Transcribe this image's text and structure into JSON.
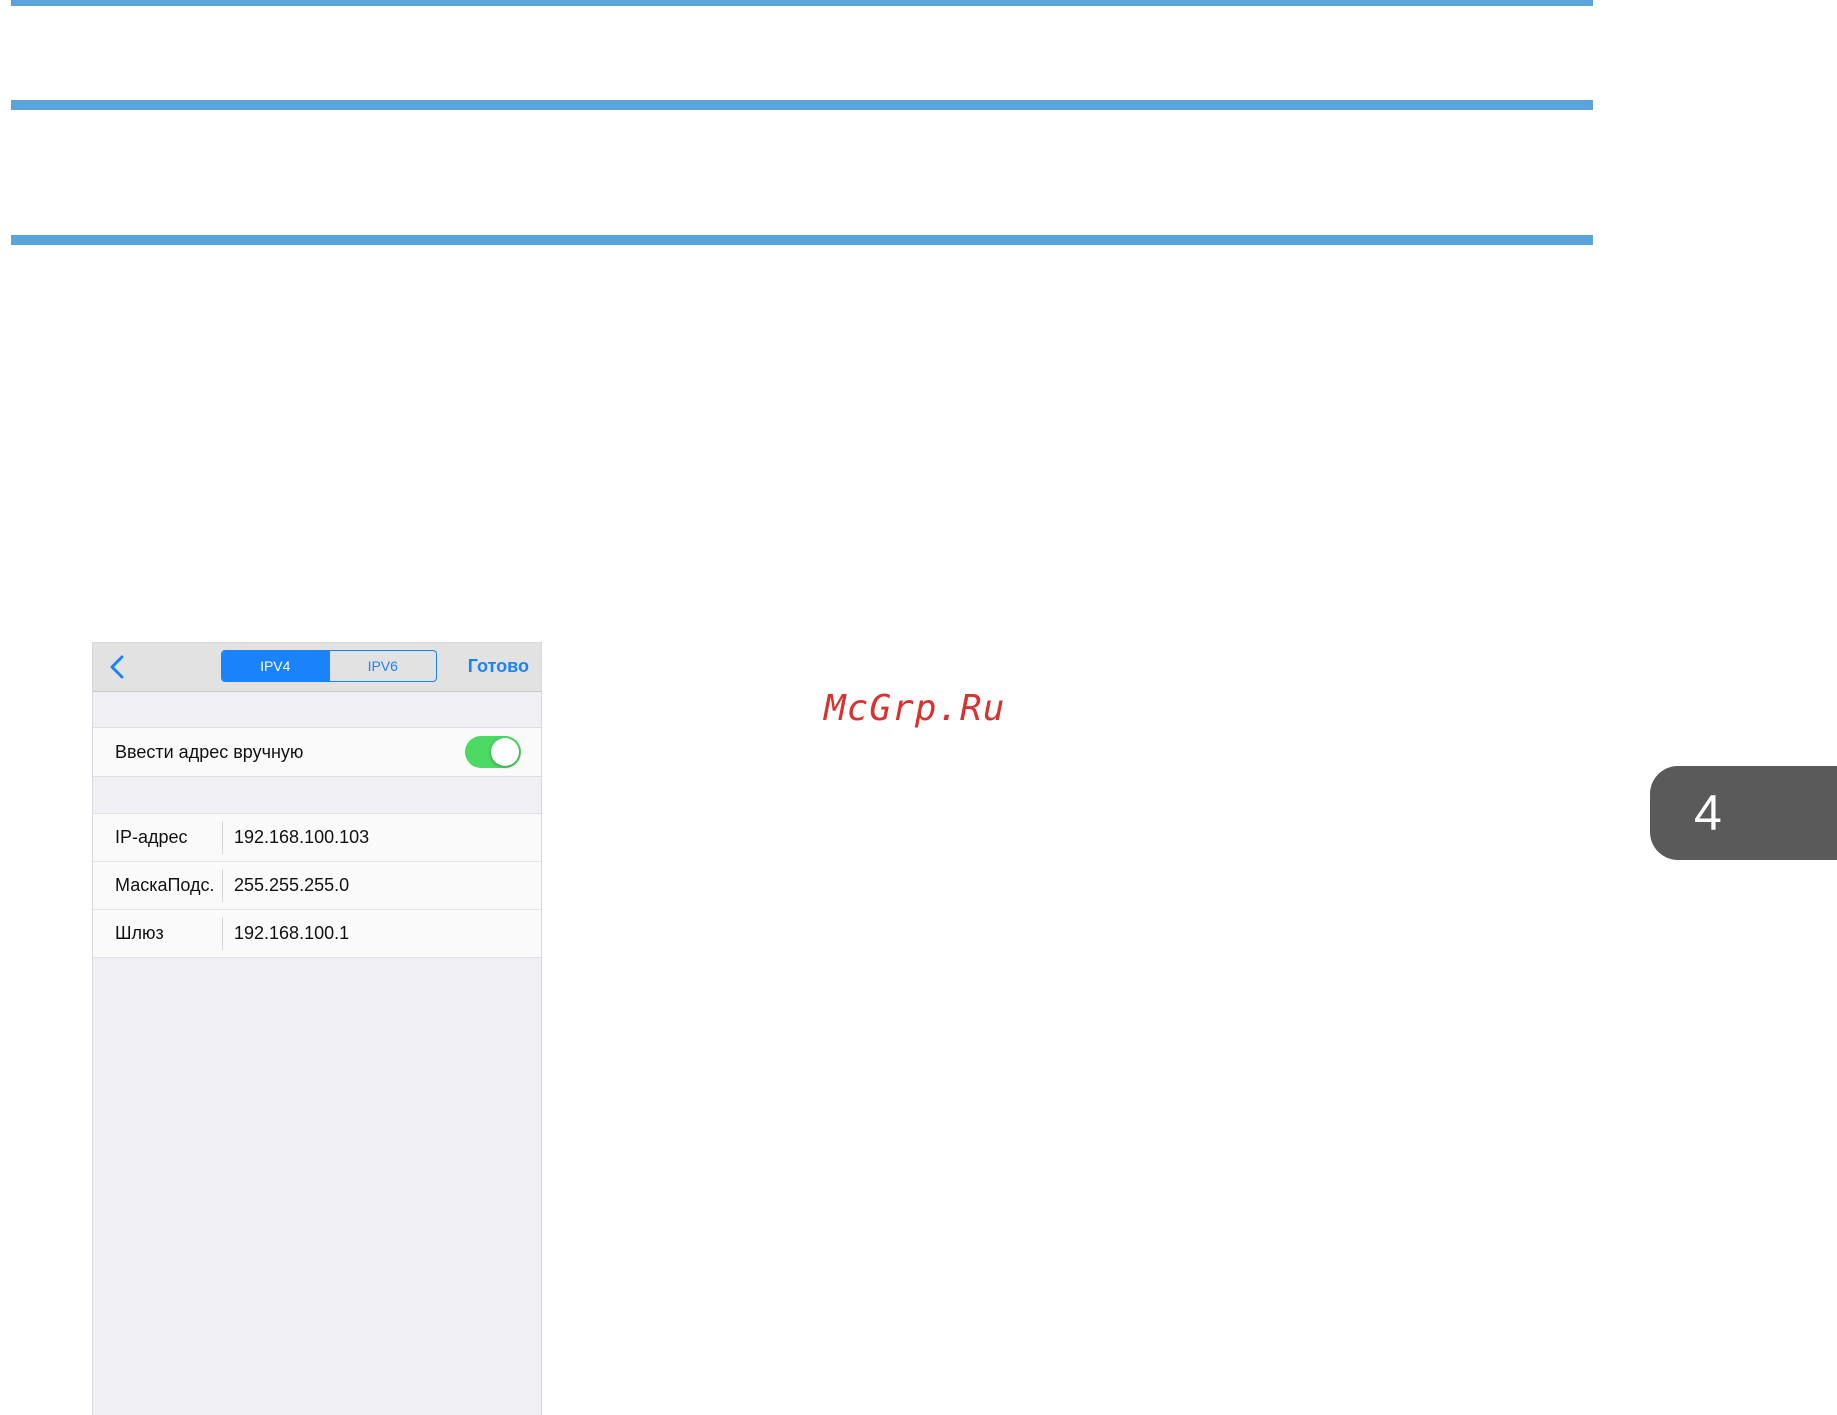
{
  "watermark": "McGrp.Ru",
  "chapter_tab": {
    "number": "4"
  },
  "screen": {
    "navbar": {
      "back_icon": "chevron-left-icon",
      "segments": [
        {
          "label": "IPV4",
          "selected": true
        },
        {
          "label": "IPV6",
          "selected": false
        }
      ],
      "done_label": "Готово"
    },
    "manual_entry": {
      "label": "Ввести адрес вручную",
      "enabled": true
    },
    "fields": [
      {
        "label": "IP-адрес",
        "value": "192.168.100.103"
      },
      {
        "label": "МаскаПодс.",
        "value": "255.255.255.0"
      },
      {
        "label": "Шлюз",
        "value": "192.168.100.1"
      }
    ]
  },
  "colors": {
    "accent": "#1a82fb",
    "toggle_on": "#4cd964",
    "rule": "#5aa3dd",
    "watermark": "#d9312f",
    "tab": "#5a5a5a"
  }
}
